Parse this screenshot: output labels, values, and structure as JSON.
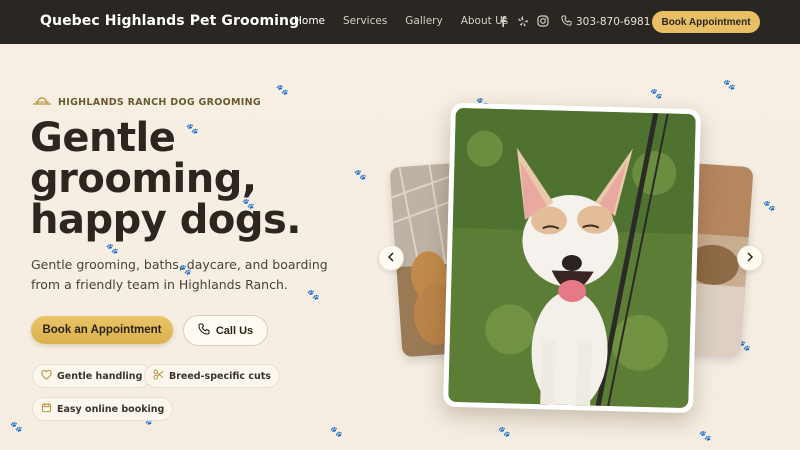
{
  "nav": {
    "brand": "Quebec Highlands Pet Grooming",
    "links": [
      "Home",
      "Services",
      "Gallery",
      "About Us"
    ],
    "social_icons": [
      "facebook-icon",
      "yelp-icon",
      "instagram-icon"
    ],
    "phone": "303-870-6981",
    "book_label": "Book Appointment"
  },
  "hero": {
    "eyebrow": "HIGHLANDS RANCH DOG GROOMING",
    "headline_lines": [
      "Gentle",
      "grooming,",
      "happy dogs."
    ],
    "subtext": "Gentle grooming, baths, daycare, and boarding from a friendly team in Highlands Ranch.",
    "primary_cta": "Book an Appointment",
    "secondary_cta": "Call Us",
    "chips": [
      {
        "label": "Gentle handling",
        "icon": "heart-icon"
      },
      {
        "label": "Breed-specific cuts",
        "icon": "scissors-icon"
      },
      {
        "label": "Easy online booking",
        "icon": "calendar-icon"
      }
    ]
  },
  "carousel": {
    "prev_icon": "chevron-left-icon",
    "next_icon": "chevron-right-icon"
  },
  "colors": {
    "nav_bg": "#2a2622",
    "accent": "#e8c063",
    "page_bg": "#f6efe4"
  }
}
